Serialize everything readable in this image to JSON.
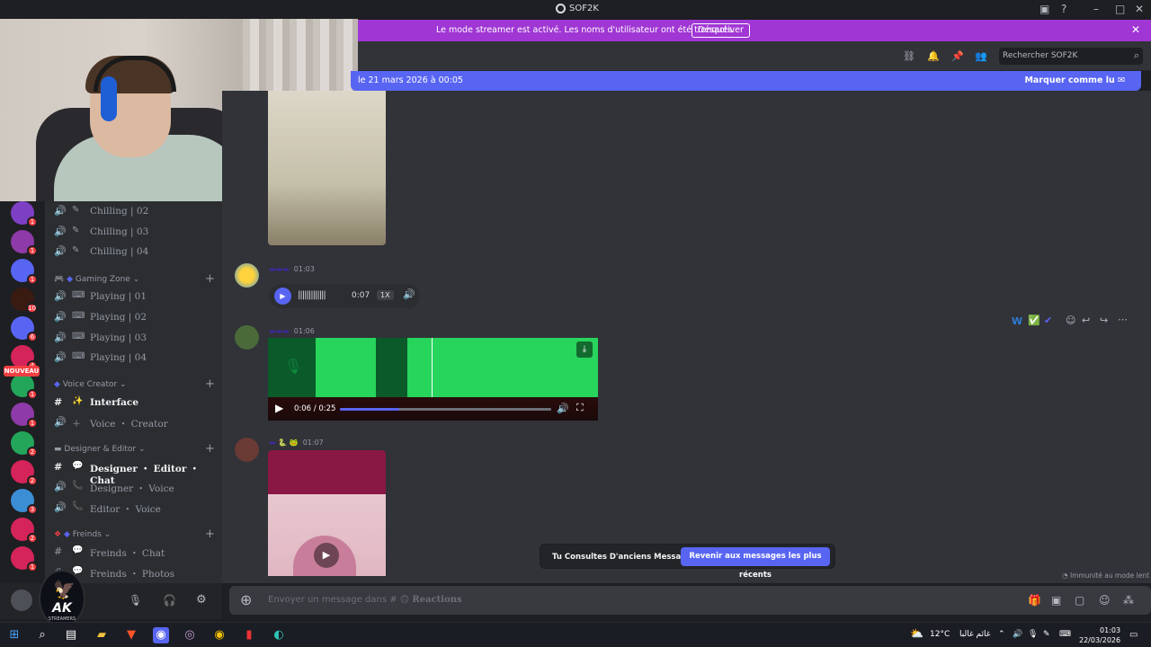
{
  "window": {
    "title": "SOF2K"
  },
  "banner": {
    "text": "Le mode streamer est activé. Les noms d'utilisateur ont été tronqués.",
    "button": "Désactiver"
  },
  "header": {
    "search_placeholder": "Rechercher SOF2K"
  },
  "newbar": {
    "text": "le 21 mars 2026 à 00:05",
    "action": "Marquer comme lu"
  },
  "servers": [
    {
      "badge": "1",
      "color": "#7d3fc4"
    },
    {
      "badge": "1",
      "color": "#8e3aa8"
    },
    {
      "badge": "1",
      "color": "#5865f2"
    },
    {
      "badge": "10",
      "color": "#3a1b12"
    },
    {
      "badge": "6",
      "color": "#5865f2"
    },
    {
      "badge": "4",
      "color": "#d4245a"
    },
    {
      "badge": "1",
      "color": "#23a55a"
    },
    {
      "badge": "1",
      "color": "#8e3aa8"
    },
    {
      "badge": "2",
      "color": "#23a55a"
    },
    {
      "badge": "2",
      "color": "#d4245a"
    },
    {
      "badge": "3",
      "color": "#3b8ed4"
    },
    {
      "badge": "2",
      "color": "#d4245a"
    },
    {
      "badge": "1",
      "color": "#d4245a"
    }
  ],
  "nouveau": "NOUVEAU",
  "channels": {
    "chilling": [
      "Chilling | 02",
      "Chilling | 03",
      "Chilling | 04"
    ],
    "gaming_cat": "Gaming Zone",
    "gaming": [
      "Playing | 01",
      "Playing | 02",
      "Playing | 03",
      "Playing | 04"
    ],
    "voice_cat": "Voice Creator",
    "voice": [
      "Interface",
      "Voice ・ Creator"
    ],
    "designer_cat": "Designer & Editor",
    "designer": [
      "Designer ・ Editor ・ Chat",
      "Designer ・ Voice",
      "Editor ・ Voice"
    ],
    "freinds_cat": "Freinds",
    "freinds": [
      "Freinds ・ Chat",
      "Freinds ・ Photos"
    ]
  },
  "user": {
    "logo_text": "AK",
    "logo_sub": "STREAMERS"
  },
  "messages": [
    {
      "time": "01:03",
      "voice_time": "0:07",
      "speed": "1X"
    },
    {
      "time": "01:06",
      "video_time": "0:06 / 0:25",
      "progress": 0.28
    },
    {
      "time": "01:07"
    }
  ],
  "toast": {
    "text": "Tu Consultes D'anciens Messages",
    "button": "Revenir aux messages les plus récents"
  },
  "immunity": "Immunité au mode lent",
  "composer": {
    "placeholder": "Envoyer un message dans #",
    "channel": "Reactions"
  },
  "taskbar": {
    "weather": "12°C",
    "weather_text": "غائم غالبا",
    "time": "01:03",
    "date": "22/03/2026"
  }
}
